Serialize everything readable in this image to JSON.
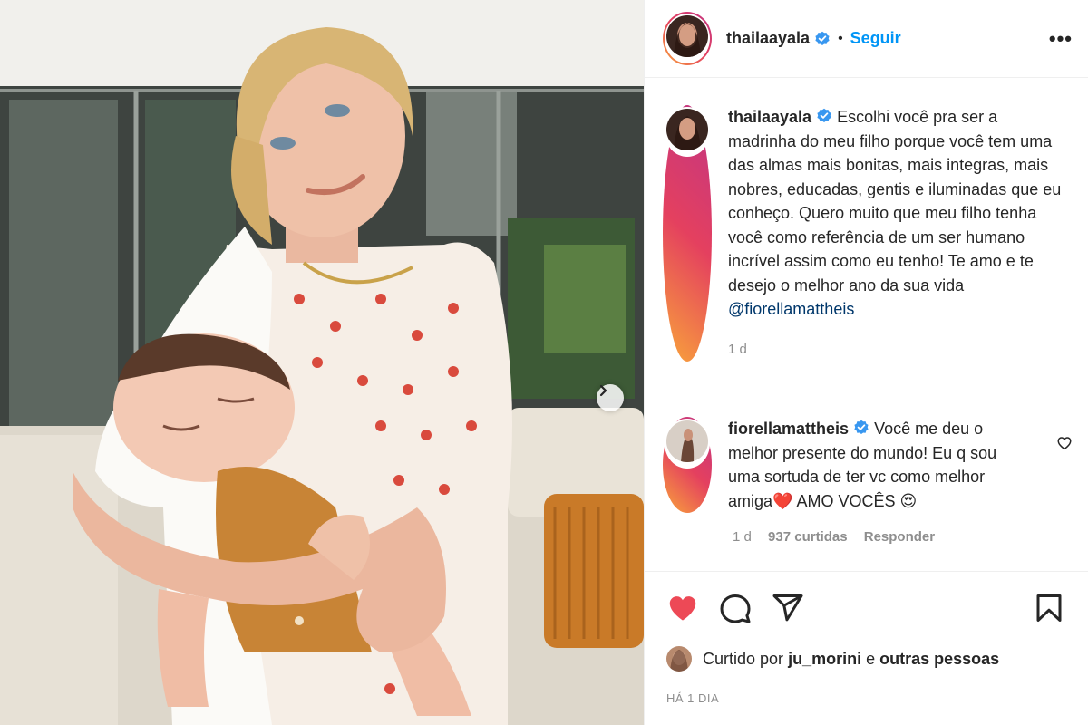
{
  "post": {
    "author": "thailaayala",
    "follow_label": "Seguir",
    "separator": "•",
    "more_label": "•••",
    "caption": {
      "username": "thailaayala",
      "text": "Escolhi você pra ser a madrinha do meu filho porque você tem uma das almas mais bonitas, mais integras, mais nobres, educadas, gentis e iluminadas que eu conheço. Quero muito que meu filho tenha você como referência de um ser humano incrível assim como eu tenho! Te amo e te desejo o melhor ano da sua vida",
      "mention": "@fiorellamattheis",
      "age": "1 d"
    },
    "comment": {
      "username": "fiorellamattheis",
      "text_before_heart": "Você me deu o melhor presente do mundo! Eu q sou uma sortuda de ter vc como melhor amiga",
      "emoji_heart": "❤️",
      "text_after_heart": " AMO VOCÊS ",
      "emoji_face": "😍",
      "age": "1 d",
      "likes": "937 curtidas",
      "reply_label": "Responder"
    },
    "likes": {
      "prefix": "Curtido por",
      "user": "ju_morini",
      "joiner": "e",
      "others": "outras pessoas"
    },
    "timestamp": "HÁ 1 DIA"
  },
  "icons": {
    "verified": "verified-badge-icon",
    "like": "heart-icon",
    "comment": "comment-icon",
    "share": "share-icon",
    "save": "bookmark-icon",
    "next": "chevron-right-icon",
    "comment_like": "heart-outline-icon"
  },
  "colors": {
    "like_red": "#ed4956",
    "link_blue": "#0095f6",
    "verified_blue": "#3897f0",
    "mention_blue": "#00376b"
  }
}
